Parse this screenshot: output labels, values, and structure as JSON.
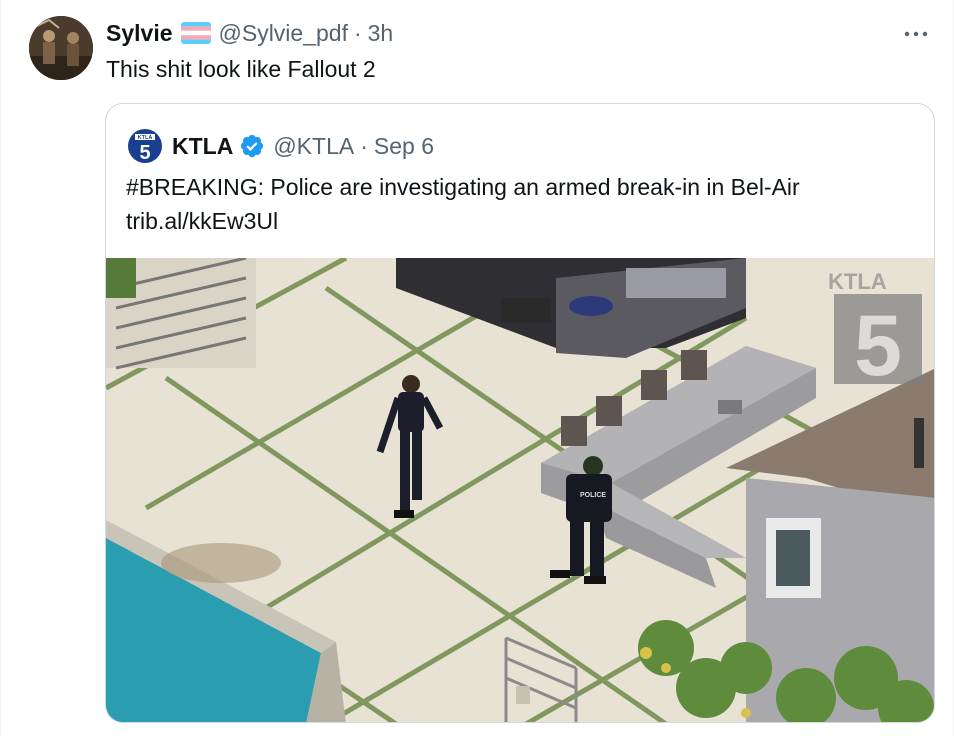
{
  "tweet": {
    "display_name": "Sylvie",
    "handle": "@Sylvie_pdf",
    "separator": "·",
    "time": "3h",
    "text": "This shit look like Fallout 2",
    "more_icon": "more-horizontal-icon",
    "flag_icon": "transgender-flag-icon"
  },
  "quote": {
    "display_name": "KTLA",
    "handle": "@KTLA",
    "separator": "·",
    "date": "Sep 6",
    "text_line1": "#BREAKING: Police are investigating an armed break-in in Bel-Air",
    "text_line2": "trib.al/kkEw3Ul",
    "logo_text": "KTLA",
    "logo_number": "5",
    "verified_icon": "verified-badge-icon",
    "verified_color": "#1d9bf0",
    "media": {
      "watermark_text": "KTLA",
      "watermark_number": "5",
      "badge_text": "POLICE"
    }
  }
}
